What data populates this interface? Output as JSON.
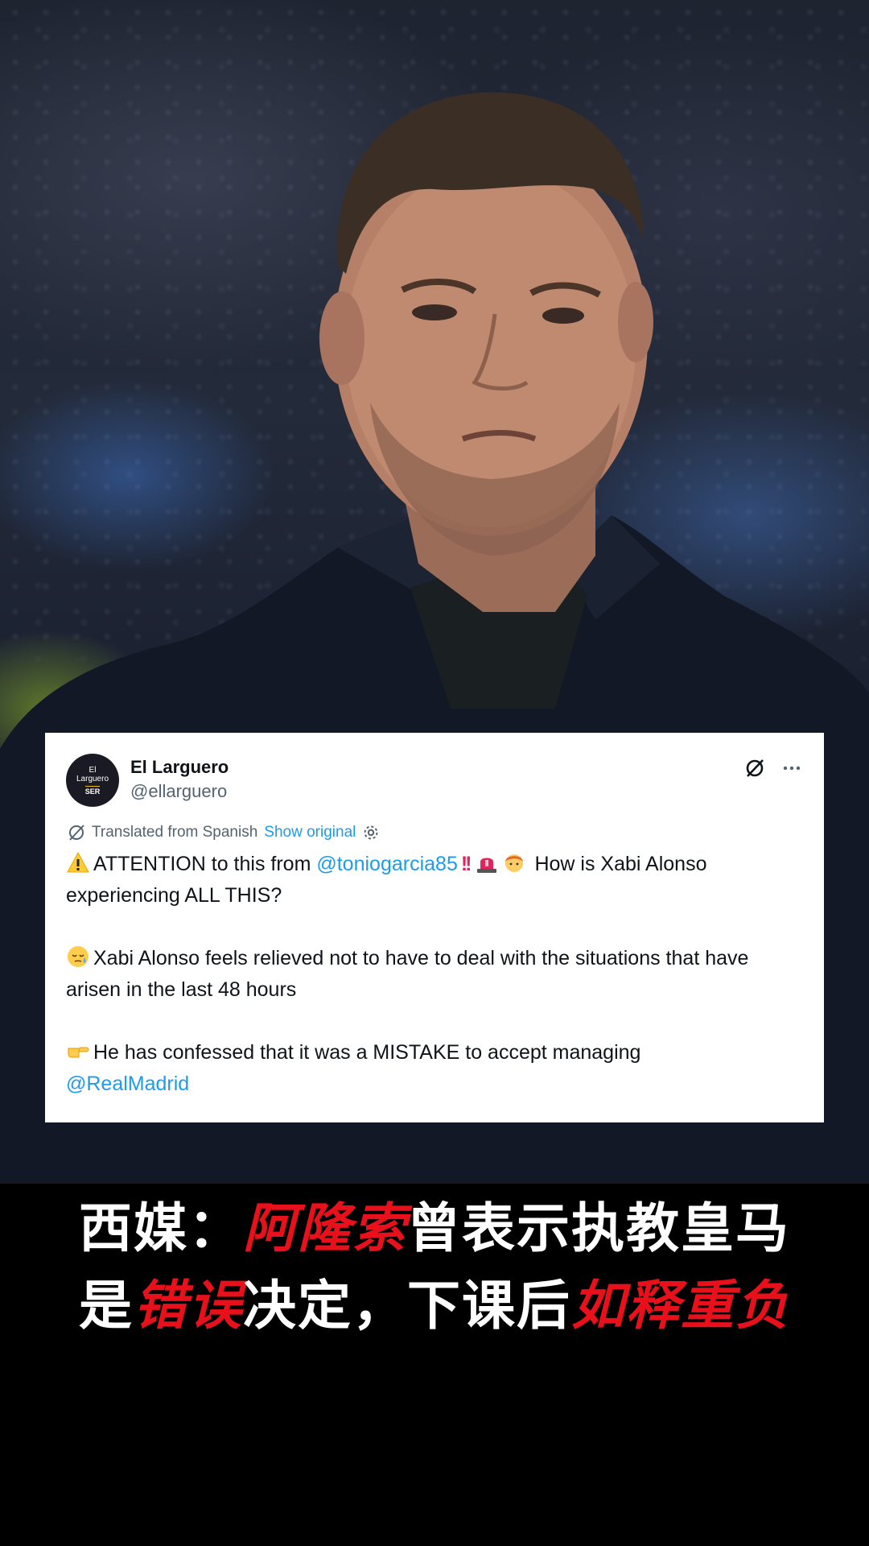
{
  "tweet": {
    "author": {
      "display_name": "El Larguero",
      "handle": "@ellarguero",
      "avatar_lines": [
        "El",
        "Larguero",
        "SER"
      ]
    },
    "translation": {
      "label": "Translated from Spanish",
      "show_original": "Show original"
    },
    "paragraph1": {
      "prefix": "ATTENTION to this from",
      "mention": "@toniogarcia85",
      "suffix": "How is Xabi Alonso experiencing ALL THIS?"
    },
    "paragraph2": {
      "text": "Xabi Alonso feels relieved not to have to deal with the situations that have arisen in the last 48 hours"
    },
    "paragraph3": {
      "text": "He has confessed that it was a MISTAKE to accept managing",
      "mention": "@RealMadrid"
    },
    "icons": [
      "grok-icon",
      "more-icon",
      "translate-icon",
      "settings-icon"
    ]
  },
  "caption": {
    "line1": [
      {
        "text": "西媒：",
        "color": "white"
      },
      {
        "text": "阿隆索",
        "color": "red"
      },
      {
        "text": "曾表示执教皇马",
        "color": "white"
      }
    ],
    "line2": [
      {
        "text": "是",
        "color": "white"
      },
      {
        "text": "错误",
        "color": "red"
      },
      {
        "text": "决定，下课后",
        "color": "white"
      },
      {
        "text": "如释重负",
        "color": "red"
      }
    ]
  },
  "colors": {
    "caption_red": "#e8101a",
    "link_blue": "#1d9bf0",
    "background": "#000000"
  }
}
